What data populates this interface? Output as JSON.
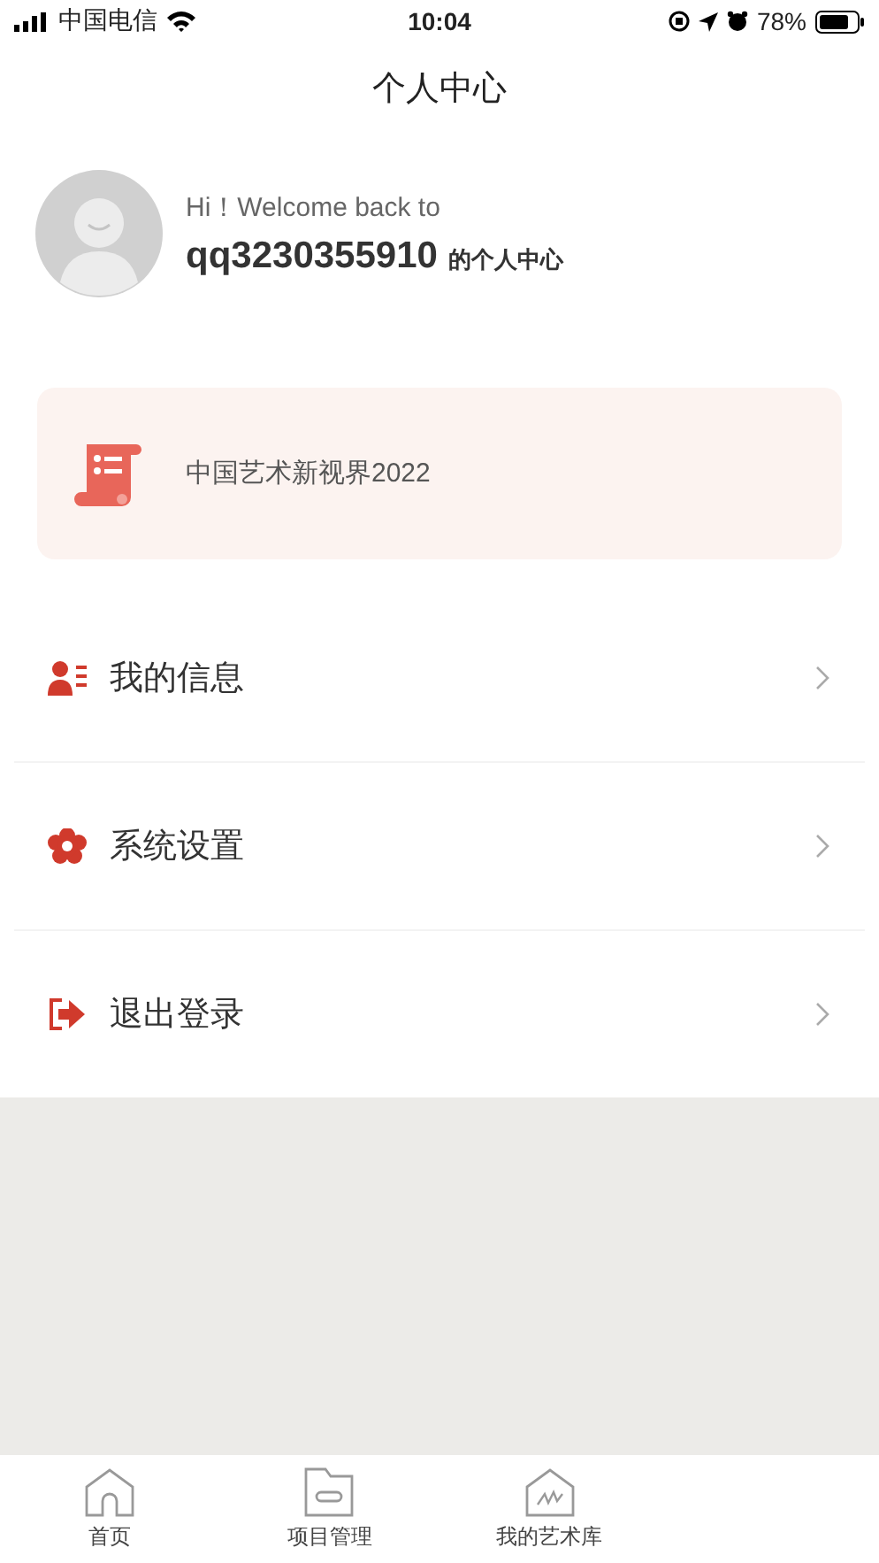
{
  "status_bar": {
    "carrier": "中国电信",
    "time": "10:04",
    "battery": "78%"
  },
  "header": {
    "title": "个人中心"
  },
  "profile": {
    "greeting": "Hi！Welcome back to",
    "username": "qq3230355910",
    "suffix": "的个人中心"
  },
  "project_card": {
    "title": "中国艺术新视界2022"
  },
  "menu": [
    {
      "kind": "info",
      "label": "我的信息"
    },
    {
      "kind": "settings",
      "label": "系统设置"
    },
    {
      "kind": "logout",
      "label": "退出登录"
    }
  ],
  "tab_bar": [
    {
      "kind": "home",
      "label": "首页",
      "selected": false
    },
    {
      "kind": "projects",
      "label": "项目管理",
      "selected": false
    },
    {
      "kind": "library",
      "label": "我的艺术库",
      "selected": false
    }
  ]
}
